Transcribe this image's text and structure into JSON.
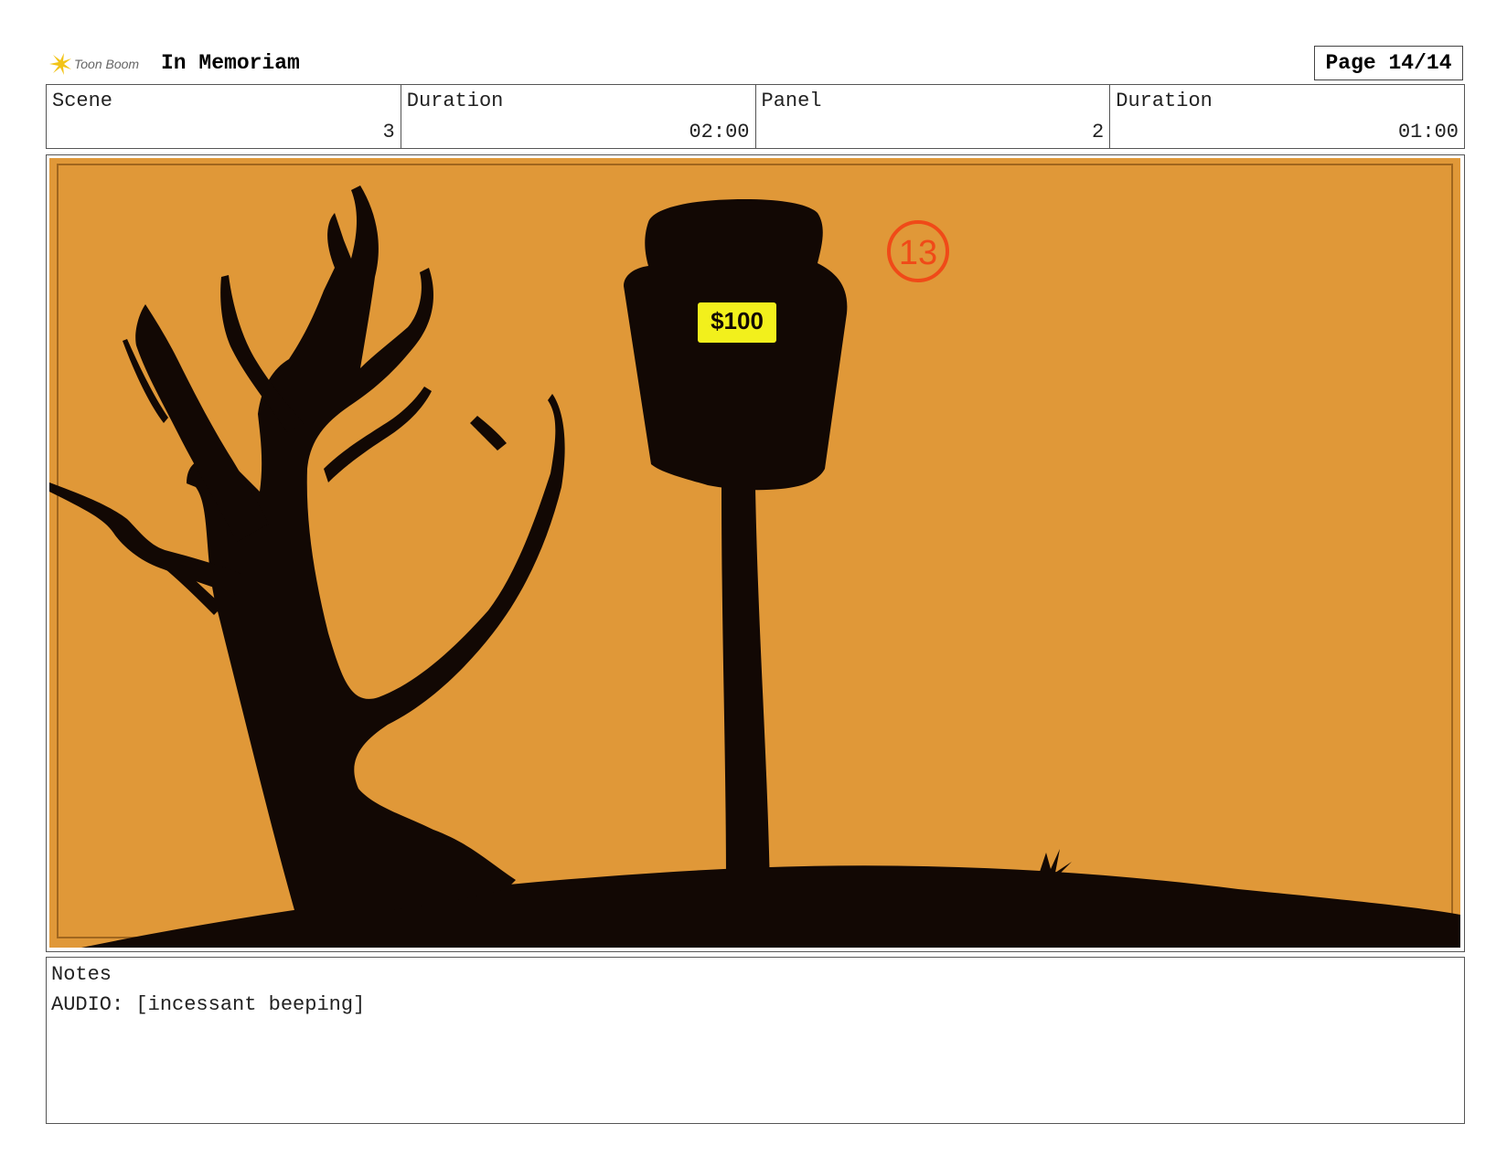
{
  "header": {
    "logo_text": "Toon Boom",
    "title": "In Memoriam",
    "page_label": "Page 14/14"
  },
  "info": {
    "scene_label": "Scene",
    "scene_value": "3",
    "scene_duration_label": "Duration",
    "scene_duration_value": "02:00",
    "panel_label": "Panel",
    "panel_value": "2",
    "panel_duration_label": "Duration",
    "panel_duration_value": "01:00"
  },
  "panel": {
    "sign_price": "$100",
    "shot_number": "13",
    "colors": {
      "sky": "#E09838",
      "safe_frame": "#A0661E",
      "silhouette": "#120804",
      "price_tag": "#F2F01C",
      "annotation": "#F04A18"
    }
  },
  "notes": {
    "label": "Notes",
    "text": "AUDIO: [incessant beeping]"
  }
}
